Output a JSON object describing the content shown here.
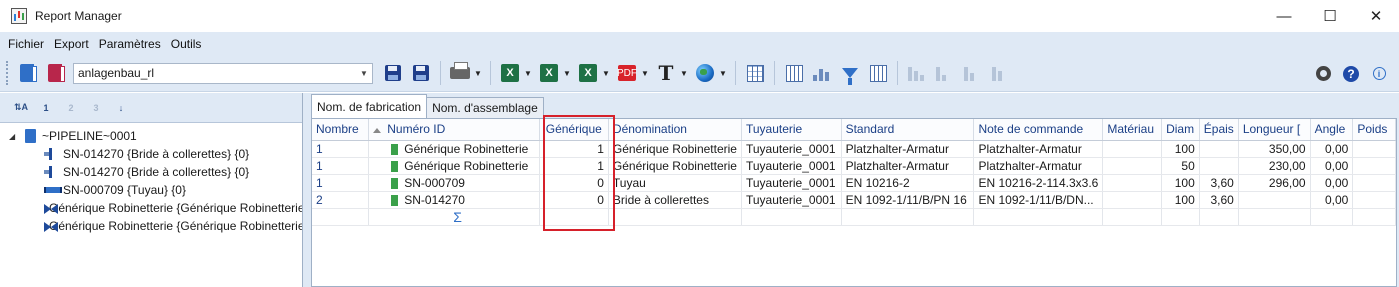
{
  "window": {
    "title": "Report Manager",
    "minimize_icon": "minimize-icon",
    "maximize_icon": "maximize-icon",
    "close_icon": "close-icon",
    "minimize_glyph": "—",
    "maximize_glyph": "☐",
    "close_glyph": "✕"
  },
  "menu": [
    "Fichier",
    "Export",
    "Paramètres",
    "Outils"
  ],
  "toolbar": {
    "report_combo_value": "anlagenbau_rl",
    "xls_glyph": "X",
    "pdf_glyph": "PDF",
    "text_glyph": "T",
    "help_glyph": "?",
    "info_glyph": "i"
  },
  "left_toolbar": [
    "⇅A",
    "1",
    "2",
    "3",
    "↓"
  ],
  "tree": {
    "root": "~PIPELINE~0001",
    "children": [
      {
        "label": "SN-014270 {Bride à collerettes} {0}",
        "icon": "flange-icon"
      },
      {
        "label": "SN-014270 {Bride à collerettes} {0}",
        "icon": "flange-icon"
      },
      {
        "label": "SN-000709 {Tuyau} {0}",
        "icon": "pipe-icon"
      },
      {
        "label": "Générique Robinetterie {Générique Robinetterie",
        "icon": "valve-icon"
      },
      {
        "label": "Générique Robinetterie {Générique Robinetterie",
        "icon": "valve-icon"
      }
    ]
  },
  "tabs": [
    "Nom. de fabrication",
    "Nom. d'assemblage"
  ],
  "grid": {
    "columns": [
      "Nombre",
      "Numéro ID",
      "Générique",
      "Dénomination",
      "Tuyauterie",
      "Standard",
      "Note de commande",
      "Matériau",
      "Diam",
      "Épais",
      "Longueur [",
      "Angle",
      "Poids"
    ],
    "rows": [
      [
        "1",
        "Générique Robinetterie",
        "1",
        "Générique Robinetterie",
        "Tuyauterie_0001",
        "Platzhalter-Armatur",
        "Platzhalter-Armatur",
        "",
        "100",
        "",
        "350,00",
        "0,00",
        ""
      ],
      [
        "1",
        "Générique Robinetterie",
        "1",
        "Générique Robinetterie",
        "Tuyauterie_0001",
        "Platzhalter-Armatur",
        "Platzhalter-Armatur",
        "",
        "50",
        "",
        "230,00",
        "0,00",
        ""
      ],
      [
        "1",
        "SN-000709",
        "0",
        "Tuyau",
        "Tuyauterie_0001",
        "EN 10216-2",
        "EN 10216-2-114.3x3.6",
        "",
        "100",
        "3,60",
        "296,00",
        "0,00",
        ""
      ],
      [
        "2",
        "SN-014270",
        "0",
        "Bride à collerettes",
        "Tuyauterie_0001",
        "EN 1092-1/11/B/PN 16",
        "EN 1092-1/11/B/DN...",
        "",
        "100",
        "3,60",
        "",
        "0,00",
        ""
      ]
    ],
    "summary_symbol": "Σ"
  },
  "colors": {
    "chrome": "#dfe9f5",
    "highlight_border": "#d6202a",
    "header_text": "#1b3f86"
  }
}
